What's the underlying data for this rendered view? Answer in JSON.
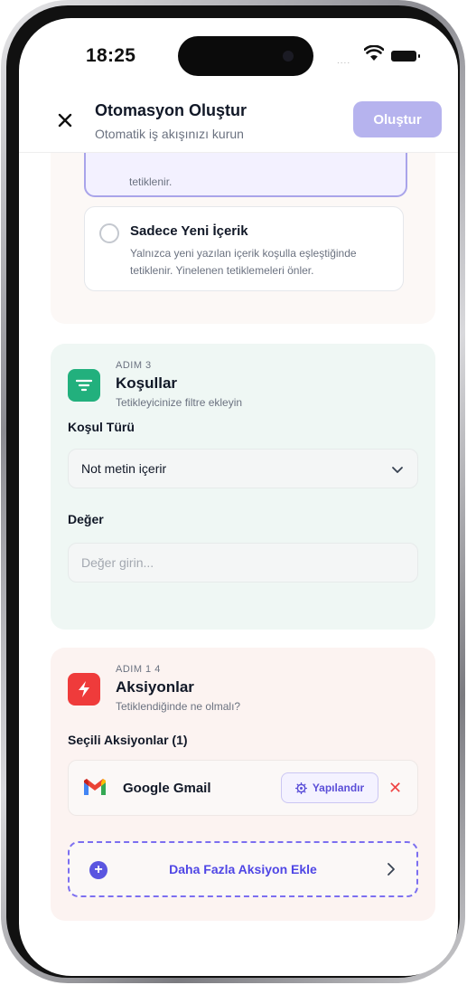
{
  "status_bar": {
    "time": "18:25",
    "signal": "....",
    "wifi_icon": "wifi-icon",
    "battery_icon": "battery-icon"
  },
  "header": {
    "title": "Otomasyon Oluştur",
    "subtitle": "Otomatik iş akışınızı kurun",
    "create_label": "Oluştur",
    "close_icon": "close-icon"
  },
  "trigger_options": {
    "selected_partial_text": "tetiklenir.",
    "new_content": {
      "title": "Sadece Yeni İçerik",
      "description": "Yalnızca yeni yazılan içerik koşulla eşleştiğinde tetiklenir. Yinelenen tetiklemeleri önler."
    }
  },
  "conditions": {
    "step_label": "ADIM 3",
    "title": "Koşullar",
    "subtitle": "Tetikleyicinize filtre ekleyin",
    "type_label": "Koşul Türü",
    "type_value": "Not metin içerir",
    "value_label": "Değer",
    "value_placeholder": "Değer girin...",
    "icon": "filter-icon",
    "accent": "#22b07d"
  },
  "actions": {
    "step_label": "ADIM 1 4",
    "title": "Aksiyonlar",
    "subtitle": "Tetiklendiğinde ne olmalı?",
    "selected_label": "Seçili Aksiyonlar (1)",
    "items": [
      {
        "name": "Google Gmail",
        "icon": "gmail-icon",
        "configure_label": "Yapılandır"
      }
    ],
    "add_more_label": "Daha Fazla Aksiyon Ekle",
    "icon": "lightning-icon",
    "accent": "#ef3b3b"
  },
  "colors": {
    "primary": "#5a55e0",
    "primary_disabled": "#b6b3ee",
    "danger": "#ef4444"
  }
}
